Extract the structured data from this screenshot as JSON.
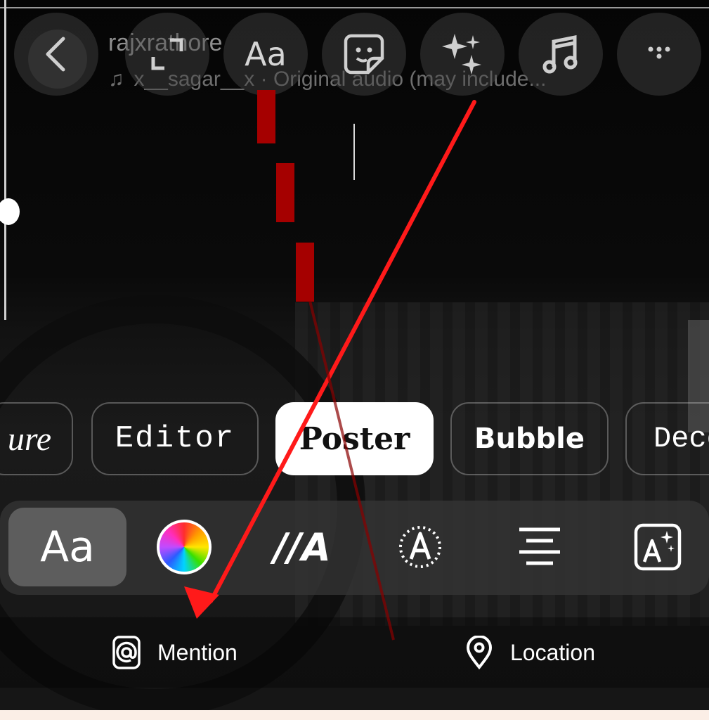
{
  "profile": {
    "username": "rajxrathore",
    "audio_text": "x__sagar__x · Original audio (may include..."
  },
  "top_toolbar": {
    "text_tool_label": "Aa"
  },
  "text_styles": [
    {
      "label": "ure"
    },
    {
      "label": "Editor"
    },
    {
      "label": "Poster"
    },
    {
      "label": "Bubble"
    },
    {
      "label": "Deco"
    }
  ],
  "selected_style": "Poster",
  "tools_bar": {
    "font_label": "Aa",
    "animation_label": "//A"
  },
  "actions": {
    "mention_label": "Mention",
    "location_label": "Location"
  },
  "colors": {
    "annotation_red": "#ff1a1a",
    "dash_red": "#a50000"
  }
}
